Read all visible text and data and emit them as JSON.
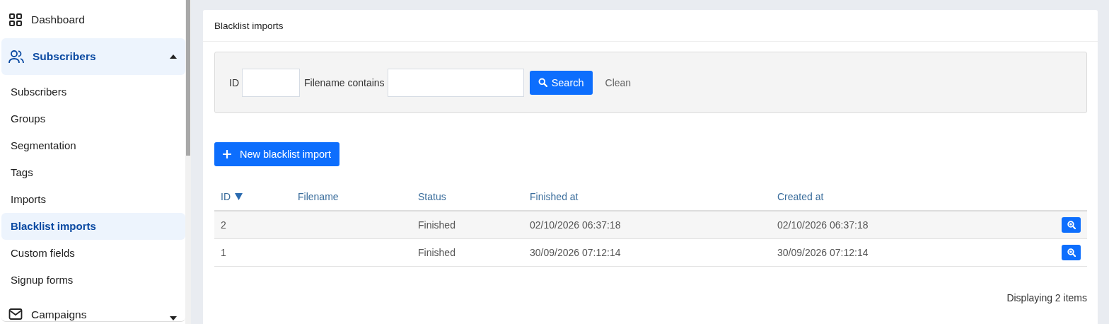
{
  "sidebar": {
    "items": [
      {
        "kind": "link",
        "label": "Dashboard",
        "selected": false
      },
      {
        "kind": "group",
        "label": "Subscribers",
        "selected": true,
        "expanded": true,
        "children": [
          {
            "label": "Subscribers",
            "selected": false
          },
          {
            "label": "Groups",
            "selected": false
          },
          {
            "label": "Segmentation",
            "selected": false
          },
          {
            "label": "Tags",
            "selected": false
          },
          {
            "label": "Imports",
            "selected": false
          },
          {
            "label": "Blacklist imports",
            "selected": true
          },
          {
            "label": "Custom fields",
            "selected": false
          },
          {
            "label": "Signup forms",
            "selected": false
          }
        ]
      },
      {
        "kind": "group",
        "label": "Campaigns",
        "selected": false,
        "expanded": false
      }
    ]
  },
  "card": {
    "title": "Blacklist imports",
    "filter": {
      "fields": [
        {
          "label": "ID"
        },
        {
          "label": "Filename contains"
        }
      ],
      "search_button": "Search",
      "clean_link": "Clean"
    },
    "new_button": "New blacklist import",
    "table": {
      "columns": [
        {
          "label": "ID",
          "sorted": true
        },
        {
          "label": "Filename",
          "sorted": false
        },
        {
          "label": "Status",
          "sorted": false
        },
        {
          "label": "Finished at",
          "sorted": false
        },
        {
          "label": "Created at",
          "sorted": false
        }
      ],
      "rows": [
        {
          "id": "2",
          "status": "Finished",
          "finished_at": "02/10/2026 06:37:18",
          "created_at": "02/10/2026 06:37:18"
        },
        {
          "id": "1",
          "status": "Finished",
          "finished_at": "30/09/2026 07:12:14",
          "created_at": "30/09/2026 07:12:14"
        }
      ]
    },
    "footer": "Displaying 2 items"
  }
}
